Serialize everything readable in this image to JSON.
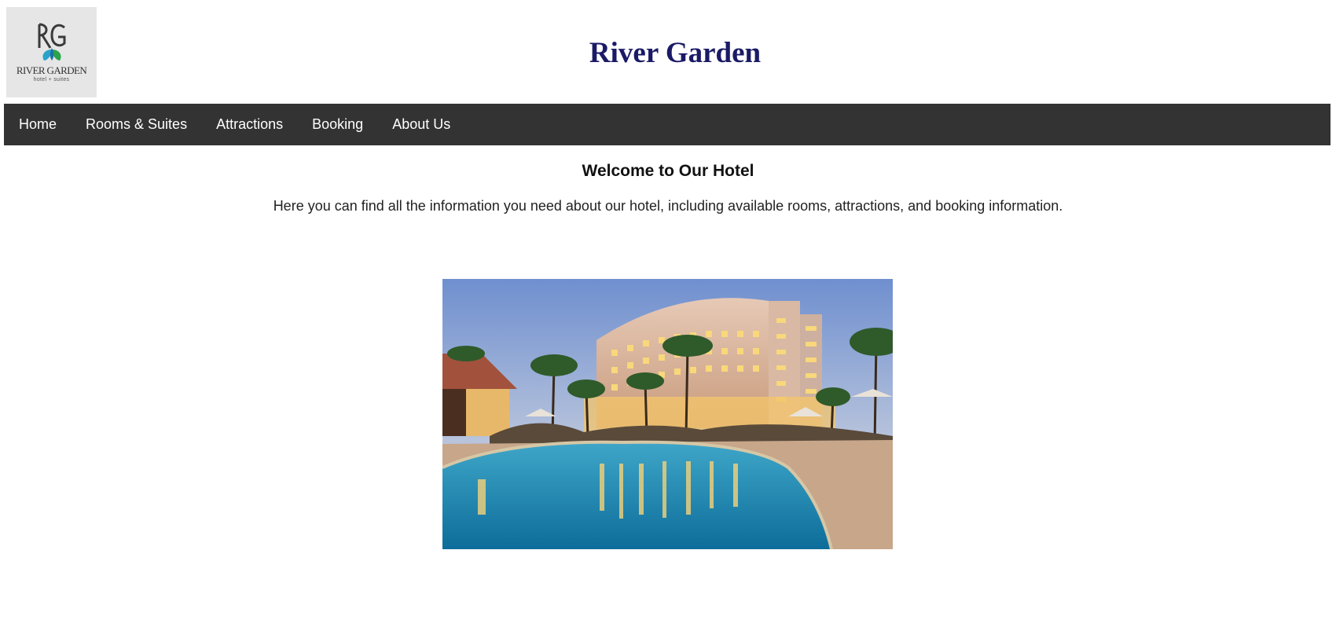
{
  "header": {
    "logo": {
      "name": "RIVER GARDEN",
      "sub": "hotel + suites"
    },
    "title": "River Garden"
  },
  "nav": {
    "items": [
      {
        "label": "Home"
      },
      {
        "label": "Rooms & Suites"
      },
      {
        "label": "Attractions"
      },
      {
        "label": "Booking"
      },
      {
        "label": "About Us"
      }
    ]
  },
  "main": {
    "heading": "Welcome to Our Hotel",
    "intro": "Here you can find all the information you need about our hotel, including available rooms, attractions, and booking information.",
    "hero_image": "hotel-pool-photo"
  },
  "colors": {
    "title": "#1a1a66",
    "nav_bg": "#333333",
    "nav_text": "#ffffff"
  }
}
